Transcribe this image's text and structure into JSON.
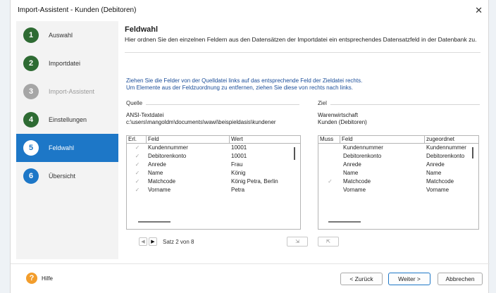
{
  "window": {
    "title": "Import-Assistent - Kunden (Debitoren)",
    "close_glyph": "✕"
  },
  "steps": [
    {
      "num": "1",
      "label": "Auswahl",
      "state": "done"
    },
    {
      "num": "2",
      "label": "Importdatei",
      "state": "done"
    },
    {
      "num": "3",
      "label": "Import-Assistent",
      "state": "disabled"
    },
    {
      "num": "4",
      "label": "Einstellungen",
      "state": "done"
    },
    {
      "num": "5",
      "label": "Feldwahl",
      "state": "active"
    },
    {
      "num": "6",
      "label": "Übersicht",
      "state": "pending"
    }
  ],
  "header": {
    "title": "Feldwahl",
    "description": "Hier ordnen Sie den einzelnen Feldern aus den Datensätzen der Importdatei ein entsprechendes Datensatzfeld in der Datenbank zu."
  },
  "instructions": {
    "line1": "Ziehen Sie die Felder von der Quelldatei links auf das entsprechende Feld der Zieldatei rechts.",
    "line2": "Um Elemente aus der Feldzuordnung zu entfernen, ziehen Sie diese von rechts nach links."
  },
  "source": {
    "group_label": "Quelle",
    "type": "ANSI-Textdatei",
    "path": "c:\\users\\mangoldm\\documents\\wawi\\beispieldasis\\kundener",
    "columns": [
      "Erl.",
      "Feld",
      "Wert"
    ],
    "rows": [
      {
        "check": "✓",
        "field": "Kundennummer",
        "value": "10001"
      },
      {
        "check": "✓",
        "field": "Debitorenkonto",
        "value": "10001"
      },
      {
        "check": "✓",
        "field": "Anrede",
        "value": "Frau"
      },
      {
        "check": "✓",
        "field": "Name",
        "value": "König"
      },
      {
        "check": "✓",
        "field": "Matchcode",
        "value": "König Petra, Berlin"
      },
      {
        "check": "✓",
        "field": "Vorname",
        "value": "Petra"
      }
    ]
  },
  "target": {
    "group_label": "Ziel",
    "type": "Warenwirtschaft",
    "subtype": "Kunden (Debitoren)",
    "columns": [
      "Muss",
      "Feld",
      "zugeordnet"
    ],
    "rows": [
      {
        "check": "",
        "field": "Kundennummer",
        "assigned": "Kundennummer"
      },
      {
        "check": "",
        "field": "Debitorenkonto",
        "assigned": "Debitorenkonto"
      },
      {
        "check": "",
        "field": "Anrede",
        "assigned": "Anrede"
      },
      {
        "check": "",
        "field": "Name",
        "assigned": "Name"
      },
      {
        "check": "✓",
        "field": "Matchcode",
        "assigned": "Matchcode"
      },
      {
        "check": "",
        "field": "Vorname",
        "assigned": "Vorname"
      }
    ]
  },
  "navigation": {
    "prev": "◀",
    "next": "▶",
    "record_text": "Satz 2 von 8",
    "assign_glyph": "⇲",
    "unassign_glyph": "⇱"
  },
  "footer": {
    "help_icon": "?",
    "help_label": "Hilfe",
    "back_label": "< Zurück",
    "next_label": "Weiter >",
    "cancel_label": "Abbrechen"
  }
}
